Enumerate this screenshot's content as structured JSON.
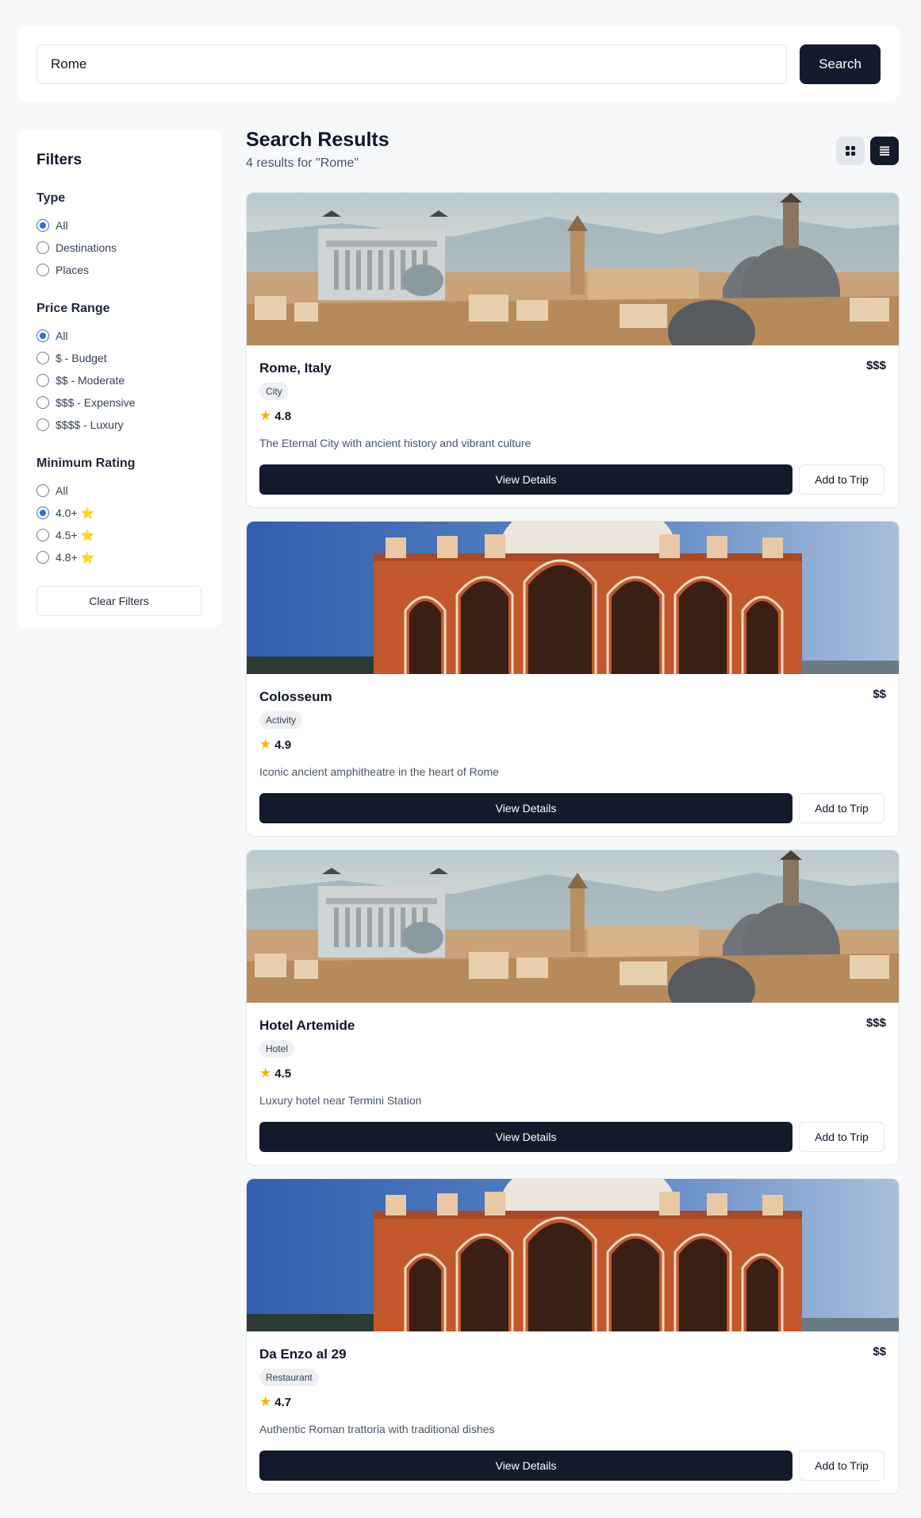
{
  "search": {
    "value": "Rome",
    "button_label": "Search"
  },
  "filters": {
    "title": "Filters",
    "groups": [
      {
        "title": "Type",
        "options": [
          {
            "label": "All",
            "checked": true
          },
          {
            "label": "Destinations",
            "checked": false
          },
          {
            "label": "Places",
            "checked": false
          }
        ]
      },
      {
        "title": "Price Range",
        "options": [
          {
            "label": "All",
            "checked": true
          },
          {
            "label": "$ - Budget",
            "checked": false
          },
          {
            "label": "$$ - Moderate",
            "checked": false
          },
          {
            "label": "$$$ - Expensive",
            "checked": false
          },
          {
            "label": "$$$$ - Luxury",
            "checked": false
          }
        ]
      },
      {
        "title": "Minimum Rating",
        "options": [
          {
            "label": "All",
            "checked": false
          },
          {
            "label": "4.0+ ⭐",
            "checked": true
          },
          {
            "label": "4.5+ ⭐",
            "checked": false
          },
          {
            "label": "4.8+ ⭐",
            "checked": false
          }
        ]
      }
    ],
    "clear_label": "Clear Filters"
  },
  "results": {
    "title": "Search Results",
    "subtitle": "4 results for \"Rome\"",
    "view_icons": [
      "grid-icon",
      "list-icon"
    ],
    "items": [
      {
        "name": "Rome, Italy",
        "price": "$$$",
        "category": "City",
        "rating": "4.8",
        "description": "The Eternal City with ancient history and vibrant culture",
        "image": "rome-skyline",
        "view_label": "View Details",
        "add_label": "Add to Trip"
      },
      {
        "name": "Colosseum",
        "price": "$$",
        "category": "Activity",
        "rating": "4.9",
        "description": "Iconic ancient amphitheatre in the heart of Rome",
        "image": "red-sandstone-monument",
        "view_label": "View Details",
        "add_label": "Add to Trip"
      },
      {
        "name": "Hotel Artemide",
        "price": "$$$",
        "category": "Hotel",
        "rating": "4.5",
        "description": "Luxury hotel near Termini Station",
        "image": "rome-skyline",
        "view_label": "View Details",
        "add_label": "Add to Trip"
      },
      {
        "name": "Da Enzo al 29",
        "price": "$$",
        "category": "Restaurant",
        "rating": "4.7",
        "description": "Authentic Roman trattoria with traditional dishes",
        "image": "red-sandstone-monument",
        "view_label": "View Details",
        "add_label": "Add to Trip"
      }
    ]
  },
  "colors": {
    "primary": "#121a2b",
    "accent": "#2f6fe0",
    "star": "#f5b400",
    "background": "#f7f8fa"
  }
}
